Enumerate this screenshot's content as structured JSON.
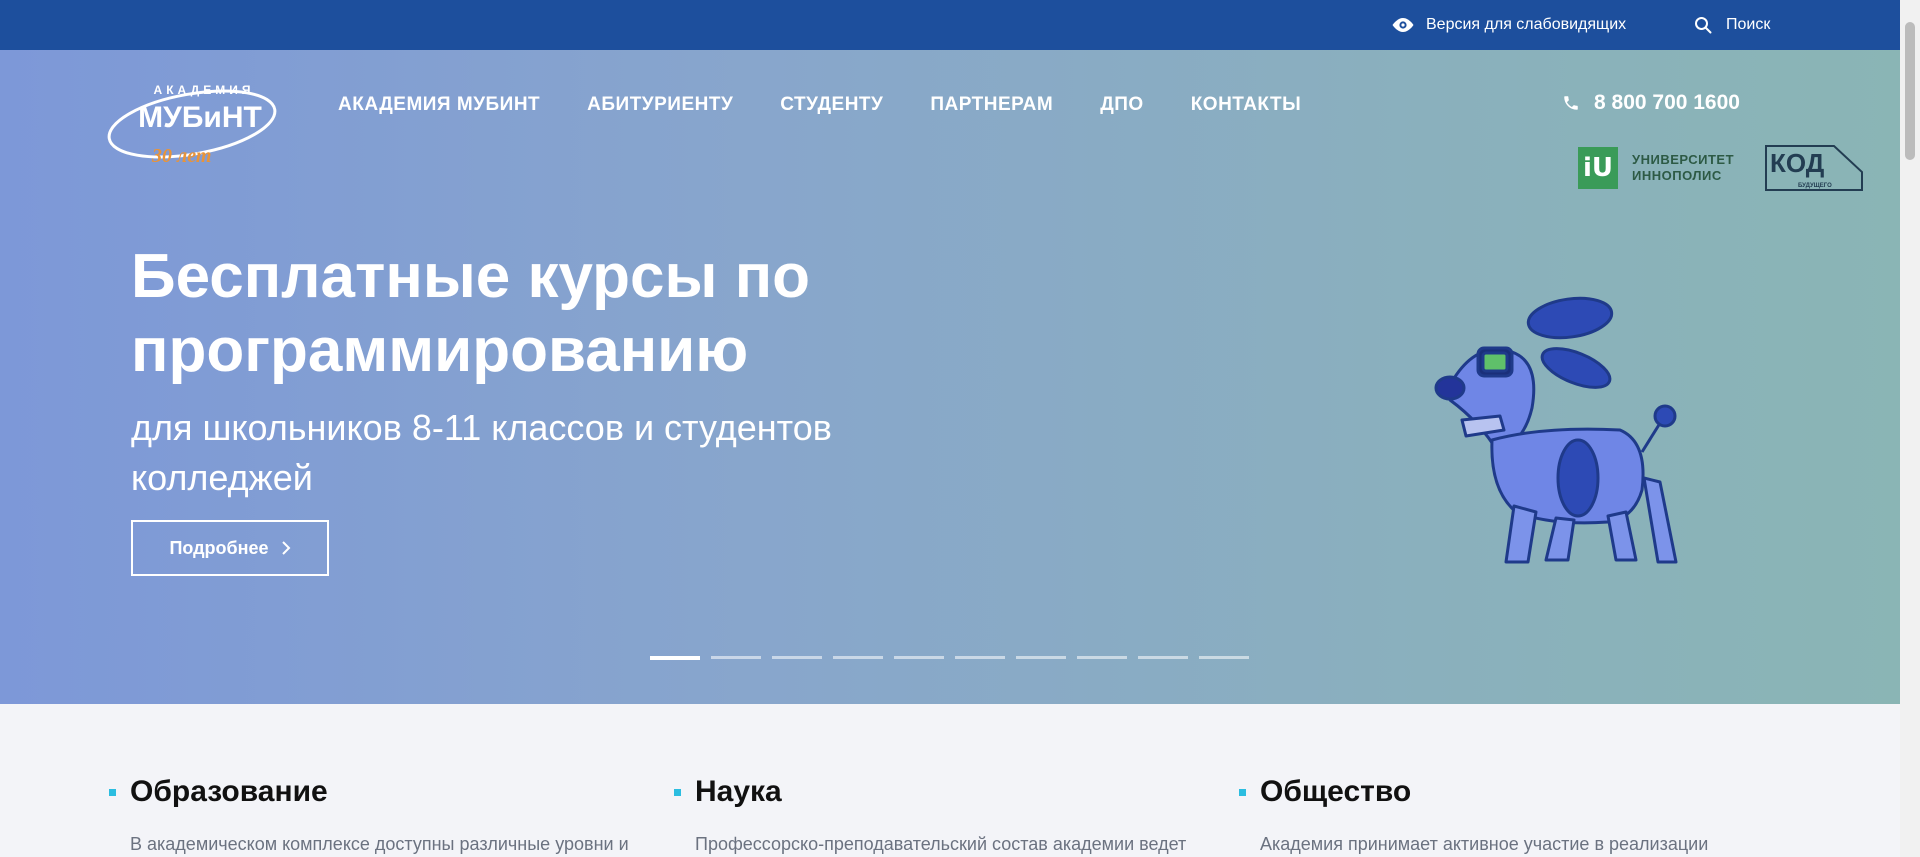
{
  "topbar": {
    "accessibility_label": "Версия для слабовидящих",
    "search_label": "Поиск"
  },
  "logo": {
    "top_text": "АКАДЕМИЯ",
    "main_text": "МУБиНТ",
    "years_text": "30 лет"
  },
  "nav": {
    "items": [
      "АКАДЕМИЯ МУБИНТ",
      "АБИТУРИЕНТУ",
      "СТУДЕНТУ",
      "ПАРТНЕРАМ",
      "ДПО",
      "КОНТАКТЫ"
    ]
  },
  "phone": "8 800 700 1600",
  "partners": {
    "innopolis_line1": "УНИВЕРСИТЕТ",
    "innopolis_line2": "ИННОПОЛИС",
    "innopolis_mark": "iU",
    "kod_text": "КОД",
    "kod_sub": "БУДУЩЕГО"
  },
  "hero": {
    "title_line1": "Бесплатные курсы по",
    "title_line2": "программированию",
    "subtitle_line1": "для школьников 8-11 классов и студентов",
    "subtitle_line2": "колледжей",
    "button_label": "Подробнее",
    "slide_count": 10,
    "active_slide": 1
  },
  "sections": [
    {
      "title": "Образование",
      "text": "В академическом комплексе доступны различные уровни и"
    },
    {
      "title": "Наука",
      "text": "Профессорско-преподавательский состав академии ведет"
    },
    {
      "title": "Общество",
      "text": "Академия принимает активное участие в реализации"
    }
  ],
  "colors": {
    "topbar": "#1d4f9d",
    "accent_square": "#2bbde0",
    "hero_gradient_start": "#7d98d8",
    "hero_gradient_end": "#8ab5b5",
    "logo_orange": "#e8943a"
  }
}
